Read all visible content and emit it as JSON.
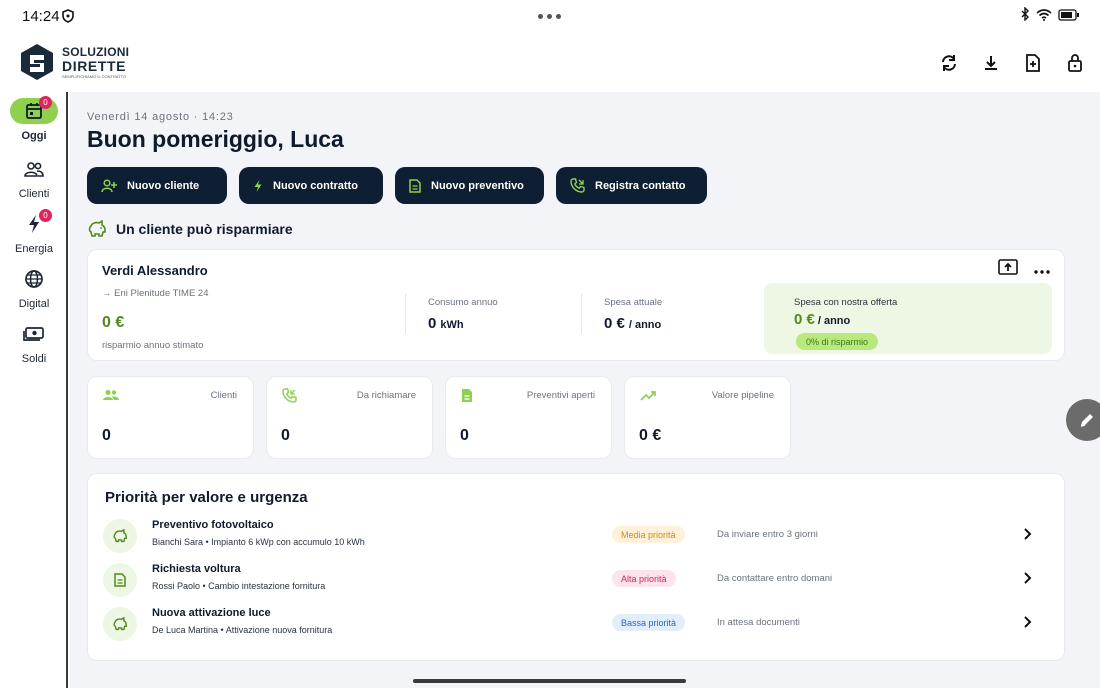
{
  "status_bar": {
    "time": "14:24"
  },
  "brand": {
    "line1": "SOLUZIONI",
    "line2": "DIRETTE",
    "tagline": "SEMPLIFICHIAMO IL CONTRATTO"
  },
  "sidebar": {
    "items": [
      {
        "label": "Oggi",
        "icon": "calendar-icon",
        "badge": "0"
      },
      {
        "label": "Clienti",
        "icon": "people-icon"
      },
      {
        "label": "Energia",
        "icon": "bolt-icon",
        "badge": "0"
      },
      {
        "label": "Digital",
        "icon": "globe-icon"
      },
      {
        "label": "Soldi",
        "icon": "money-icon"
      }
    ]
  },
  "main": {
    "date": "Venerdì 14 agosto · 14:23",
    "greeting": "Buon pomeriggio, Luca",
    "quick_actions": [
      {
        "label": "Nuovo cliente",
        "icon": "person-add-icon"
      },
      {
        "label": "Nuovo contratto",
        "icon": "bolt-icon"
      },
      {
        "label": "Nuovo preventivo",
        "icon": "document-icon"
      },
      {
        "label": "Registra contatto",
        "icon": "phone-icon"
      }
    ],
    "savings_section_title": "Un cliente può risparmiare"
  },
  "client_card": {
    "name": "Verdi Alessandro",
    "offer_line": "→ Eni Plenitude TIME 24",
    "savings_value": "0 €",
    "savings_label": "risparmio annuo stimato",
    "consumption_label": "Consumo annuo",
    "consumption_value": "0",
    "consumption_unit": "kWh",
    "current_spend_label": "Spesa attuale",
    "current_spend_value": "0 €",
    "current_spend_unit": "/ anno",
    "offer_spend_label": "Spesa con nostra offerta",
    "offer_spend_value": "0 €",
    "offer_spend_unit": "/ anno",
    "savings_pct": "0% di risparmio"
  },
  "stats": [
    {
      "label": "Clienti",
      "value": "0",
      "icon": "people-icon"
    },
    {
      "label": "Da richiamare",
      "value": "0",
      "icon": "phone-icon"
    },
    {
      "label": "Preventivi aperti",
      "value": "0",
      "icon": "document-icon"
    },
    {
      "label": "Valore pipeline",
      "value": "0 €",
      "icon": "trend-icon"
    }
  ],
  "priority": {
    "title": "Priorità per valore e urgenza",
    "rows": [
      {
        "name": "Preventivo fotovoltaico",
        "sub": "Bianchi Sara • Impianto 6 kWp con accumulo 10 kWh",
        "tag": "Media priorità",
        "note": "Da inviare entro 3 giorni",
        "icon": "piggy-bank-icon"
      },
      {
        "name": "Richiesta voltura",
        "sub": "Rossi Paolo • Cambio intestazione fornitura",
        "tag": "Alta priorità",
        "note": "Da contattare entro domani",
        "icon": "document-icon"
      },
      {
        "name": "Nuova attivazione luce",
        "sub": "De Luca Martina • Attivazione nuova fornitura",
        "tag": "Bassa priorità",
        "note": "In attesa documenti",
        "icon": "piggy-bank-icon"
      }
    ]
  },
  "colors": {
    "navy": "#0e1e33",
    "accent_green": "#8fd14f",
    "money_green": "#4f8a1b",
    "badge_pink": "#e0245e",
    "tag_medium_bg": "#fdf1dc",
    "tag_medium_fg": "#d48a12",
    "tag_high_bg": "#fde3ec",
    "tag_high_fg": "#d0245e",
    "tag_low_bg": "#e3eefc",
    "tag_low_fg": "#2a66c8"
  }
}
